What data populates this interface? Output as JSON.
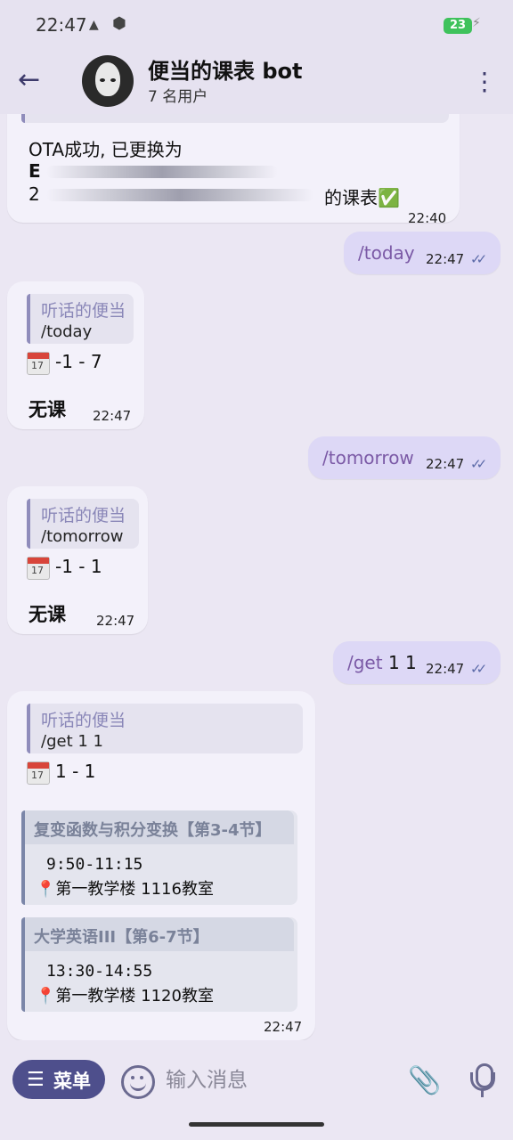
{
  "status_bar": {
    "time": "22:47",
    "battery": "23"
  },
  "header": {
    "title": "便当的课表 bot",
    "subtitle": "7 名用户"
  },
  "messages": {
    "ota": {
      "line1": "OTA成功, 已更换为",
      "line2": "E",
      "line3": "2",
      "line3_tail": "的课表✅",
      "time": "22:40"
    },
    "out_today": {
      "text": "/today",
      "time": "22:47"
    },
    "reply_today": {
      "quote_author": "听话的便当",
      "quote_text": "/today",
      "date": "-1 - 7",
      "body": "无课",
      "time": "22:47"
    },
    "out_tomorrow": {
      "text": "/tomorrow",
      "time": "22:47"
    },
    "reply_tomorrow": {
      "quote_author": "听话的便当",
      "quote_text": "/tomorrow",
      "date": "-1 - 1",
      "body": "无课",
      "time": "22:47"
    },
    "out_get": {
      "text": "/get",
      "args": "1 1",
      "time": "22:47"
    },
    "reply_get": {
      "quote_author": "听话的便当",
      "quote_text": "/get 1 1",
      "date": "1 - 1",
      "courses": [
        {
          "name": "复变函数与积分变换【第3-4节】",
          "time": "9:50-11:15",
          "location": "第一教学楼 1116教室"
        },
        {
          "name": "大学英语III【第6-7节】",
          "time": "13:30-14:55",
          "location": "第一教学楼 1120教室"
        }
      ],
      "time": "22:47"
    }
  },
  "calendar_day": "17",
  "input_bar": {
    "menu_label": "菜单",
    "placeholder": "输入消息"
  }
}
